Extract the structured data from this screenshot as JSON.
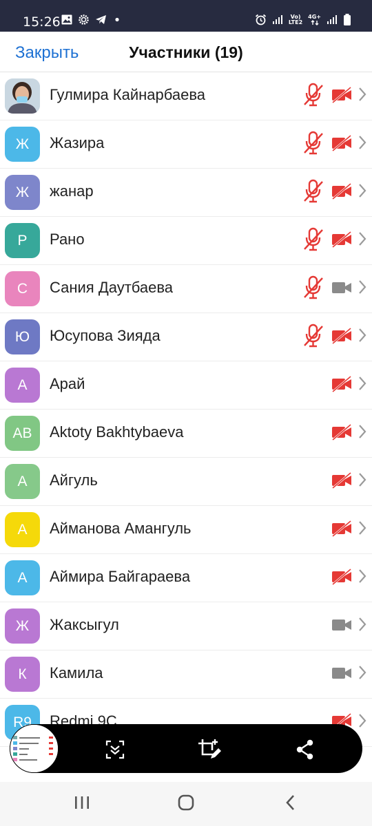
{
  "status_bar": {
    "time": "15:26",
    "network_label_top": "Vo)",
    "network_label_bottom": "LTE2",
    "network_type": "4G+",
    "icons": [
      "image-icon",
      "gear-icon",
      "telegram-icon",
      "dot-icon",
      "alarm-icon",
      "signal-icon",
      "signal-icon",
      "battery-icon"
    ]
  },
  "header": {
    "close_label": "Закрыть",
    "title": "Участники (19)"
  },
  "participants": [
    {
      "name": "Гулмира Кайнарбаева",
      "initials": "",
      "avatar_color": "#c9d7e1",
      "photo": true,
      "mic_muted": true,
      "video_off": true
    },
    {
      "name": "Жазира",
      "initials": "Ж",
      "avatar_color": "#4cb8e8",
      "mic_muted": true,
      "video_off": true
    },
    {
      "name": "жанар",
      "initials": "Ж",
      "avatar_color": "#7e86cb",
      "mic_muted": true,
      "video_off": true
    },
    {
      "name": "Рано",
      "initials": "Р",
      "avatar_color": "#37a89a",
      "mic_muted": true,
      "video_off": true
    },
    {
      "name": "Сания Даутбаева",
      "initials": "С",
      "avatar_color": "#e985bd",
      "mic_muted": true,
      "video_off": false
    },
    {
      "name": "Юсупова Зияда",
      "initials": "Ю",
      "avatar_color": "#6e79c4",
      "mic_muted": true,
      "video_off": true
    },
    {
      "name": "Арай",
      "initials": "А",
      "avatar_color": "#b978d3",
      "mic_muted": false,
      "video_off": true
    },
    {
      "name": "Aktoty Bakhtybaeva",
      "initials": "AB",
      "avatar_color": "#81c784",
      "mic_muted": false,
      "video_off": true
    },
    {
      "name": "Айгуль",
      "initials": "А",
      "avatar_color": "#86c98a",
      "mic_muted": false,
      "video_off": true
    },
    {
      "name": "Айманова Амангуль",
      "initials": "А",
      "avatar_color": "#f5d90a",
      "mic_muted": false,
      "video_off": true
    },
    {
      "name": "Аймира Байгараева",
      "initials": "А",
      "avatar_color": "#4cb8e8",
      "mic_muted": false,
      "video_off": true
    },
    {
      "name": "Жаксыгул",
      "initials": "Ж",
      "avatar_color": "#b978d3",
      "mic_muted": false,
      "video_off": false
    },
    {
      "name": "Камила",
      "initials": "К",
      "avatar_color": "#b978d3",
      "mic_muted": false,
      "video_off": false
    },
    {
      "name": "Redmi 9C",
      "initials": "R9",
      "avatar_color": "#4cb8e8",
      "mic_muted": false,
      "video_off": true
    }
  ],
  "colors": {
    "accent": "#1e71d3",
    "muted_red": "#e53935",
    "camera_gray": "#8a8a8a"
  },
  "screenshot_toolbar": {
    "buttons": [
      "scroll-capture-icon",
      "crop-edit-icon",
      "share-icon"
    ]
  },
  "navigation_bar": {
    "buttons": [
      "recent-apps-icon",
      "home-icon",
      "back-icon"
    ]
  }
}
